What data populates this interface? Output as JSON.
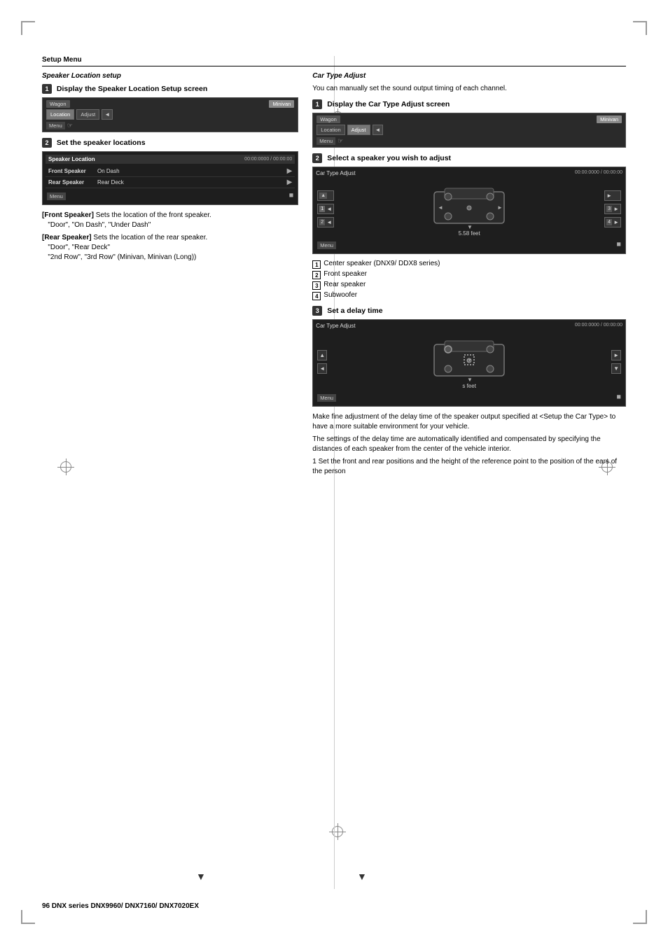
{
  "page": {
    "title": "Setup Menu",
    "footer": "96   DNX series  DNX9960/ DNX7160/ DNX7020EX"
  },
  "left_section": {
    "title": "Speaker Location setup",
    "step1": {
      "header": "Display the Speaker Location Setup screen",
      "screen": {
        "label_left": "Wagon",
        "label_right": "Minivan",
        "btn_location": "Location",
        "btn_adjust": "Adjust",
        "icon_back": "◄",
        "icon_menu": "Menu"
      }
    },
    "step2": {
      "header": "Set the speaker locations",
      "screen": {
        "title": "Speaker Location",
        "time": "00:00:0000 / 00:00:00",
        "row1_label": "Front Speaker",
        "row1_value": "On Dash",
        "row2_label": "Rear Speaker",
        "row2_value": "Rear Deck",
        "menu": "Menu"
      }
    },
    "descriptions": [
      {
        "label": "[Front Speaker]",
        "text": "Sets the location of the front speaker.",
        "options": "\"Door\", \"On Dash\", \"Under Dash\""
      },
      {
        "label": "[Rear Speaker]",
        "text": "Sets the location of the rear speaker.",
        "options": "\"Door\", \"Rear Deck\"",
        "options2": "\"2nd Row\", \"3rd Row\" (Minivan, Minivan (Long))"
      }
    ]
  },
  "right_section": {
    "title": "Car Type Adjust",
    "intro": "You can manually set the sound output timing of each channel.",
    "step1": {
      "header": "Display the Car Type Adjust screen",
      "screen": {
        "label_left": "Wagon",
        "label_right": "Minivan",
        "btn_location": "Location",
        "btn_adjust": "Adjust",
        "icon": "◄",
        "menu": "Menu"
      }
    },
    "step2": {
      "header": "Select a speaker you wish to adjust",
      "screen": {
        "title": "Car Type Adjust",
        "time": "00:00:0000 / 00:00:00",
        "distance": "5.58 feet",
        "menu": "Menu"
      },
      "items": [
        {
          "num": "1",
          "text": "Center speaker (DNX9/ DDX8 series)"
        },
        {
          "num": "2",
          "text": "Front speaker"
        },
        {
          "num": "3",
          "text": "Rear speaker"
        },
        {
          "num": "4",
          "text": "Subwoofer"
        }
      ]
    },
    "step3": {
      "header": "Set a delay time",
      "screen": {
        "title": "Car Type Adjust",
        "time": "00:00:0000 / 00:00:00",
        "menu": "Menu"
      },
      "description": [
        "Make fine adjustment of the delay time of the speaker output specified at <Setup the Car Type> to have a more suitable environment for your vehicle.",
        "The settings of the delay time are automatically identified and compensated by specifying the distances of each speaker from the center of the vehicle interior.",
        "1 Set the front and rear positions and the height of the reference point to the position of the ears of the person"
      ]
    }
  }
}
